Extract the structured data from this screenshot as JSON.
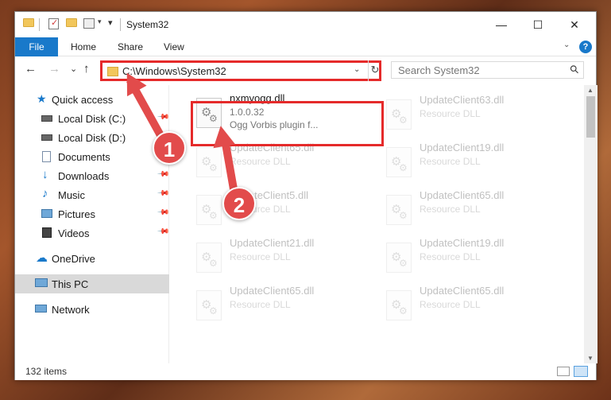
{
  "window": {
    "title": "System32",
    "controls": {
      "minimize": "—",
      "maximize": "☐",
      "close": "✕"
    }
  },
  "ribbon": {
    "file_tab": "File",
    "tabs": [
      "Home",
      "Share",
      "View"
    ],
    "help": "?"
  },
  "nav": {
    "back": "←",
    "forward": "→",
    "recent": "⌄",
    "up": "↑",
    "address_path": "C:\\Windows\\System32",
    "refresh": "↻",
    "search_placeholder": "Search System32"
  },
  "sidebar": {
    "items": [
      {
        "label": "Quick access",
        "icon": "star-icon",
        "pinned": false
      },
      {
        "label": "Local Disk (C:)",
        "icon": "drive-icon",
        "pinned": true
      },
      {
        "label": "Local Disk (D:)",
        "icon": "drive-icon",
        "pinned": true
      },
      {
        "label": "Documents",
        "icon": "documents-icon",
        "pinned": true
      },
      {
        "label": "Downloads",
        "icon": "downloads-icon",
        "pinned": true
      },
      {
        "label": "Music",
        "icon": "music-icon",
        "pinned": true
      },
      {
        "label": "Pictures",
        "icon": "pictures-icon",
        "pinned": true
      },
      {
        "label": "Videos",
        "icon": "videos-icon",
        "pinned": true
      },
      {
        "label": "OneDrive",
        "icon": "cloud-icon",
        "pinned": false
      },
      {
        "label": "This PC",
        "icon": "computer-icon",
        "pinned": false,
        "selected": true
      },
      {
        "label": "Network",
        "icon": "network-icon",
        "pinned": false
      }
    ]
  },
  "files": {
    "selected": {
      "name": "nxmyogg.dll",
      "version": "1.0.0.32",
      "description": "Ogg Vorbis plugin f..."
    },
    "background": [
      {
        "name": "UpdateClient63.dll",
        "type": "Resource DLL"
      },
      {
        "name": "UpdateClient65.dll",
        "type": "Resource DLL"
      },
      {
        "name": "UpdateClient19.dll",
        "type": "Resource DLL"
      },
      {
        "name": "UpdateClient5.dll",
        "type": "Resource DLL"
      },
      {
        "name": "UpdateClient65.dll",
        "type": "Resource DLL"
      },
      {
        "name": "UpdateClient21.dll",
        "type": "Resource DLL"
      },
      {
        "name": "UpdateClient19.dll",
        "type": "Resource DLL"
      },
      {
        "name": "UpdateClient65.dll",
        "type": "Resource DLL"
      },
      {
        "name": "UpdateClient65.dll",
        "type": "Resource DLL"
      }
    ]
  },
  "status": {
    "item_count": "132 items"
  },
  "annotations": {
    "marker_1": "1",
    "marker_2": "2"
  },
  "colors": {
    "accent": "#1979ca",
    "highlight": "#e52a2a",
    "folder": "#f2c75c",
    "selection": "#d9d9d9"
  }
}
